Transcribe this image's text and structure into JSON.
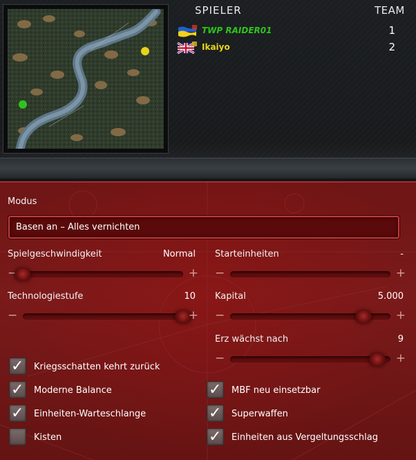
{
  "players_header": "SPIELER",
  "team_header": "TEAM",
  "players": [
    {
      "name": "TWP RAIDER01",
      "team": "1",
      "flag": "ukraine-flag",
      "color": "#2ec41d"
    },
    {
      "name": "Ikaiyo",
      "team": "2",
      "flag": "uk-flag",
      "color": "#e7d51a"
    }
  ],
  "settings": {
    "mode_label": "Modus",
    "mode_value": "Basen an – Alles vernichten",
    "game_speed": {
      "label": "Spielgeschwindigkeit",
      "value": "Normal",
      "position": 0.0
    },
    "start_units": {
      "label": "Starteinheiten",
      "value": "-",
      "position": 0.0
    },
    "tech_level": {
      "label": "Technologiestufe",
      "value": "10",
      "position": 1.0
    },
    "capital": {
      "label": "Kapital",
      "value": "5.000",
      "position": 0.83
    },
    "ore_growth": {
      "label": "Erz wächst nach",
      "value": "9",
      "position": 0.92
    }
  },
  "options": [
    {
      "label": "Kriegsschatten kehrt zurück",
      "checked": true
    },
    {
      "label": "Moderne Balance",
      "checked": true
    },
    {
      "label": "Einheiten-Warteschlange",
      "checked": true
    },
    {
      "label": "Kisten",
      "checked": false
    },
    {
      "label": "MBF neu einsetzbar",
      "checked": true
    },
    {
      "label": "Superwaffen",
      "checked": true
    },
    {
      "label": "Einheiten aus Vergeltungsschlag",
      "checked": true
    }
  ],
  "slider_symbols": {
    "minus": "−",
    "plus": "+"
  },
  "check_symbol": "✓",
  "colors": {
    "panel": "#7a1a1a",
    "accent": "#c23a3a",
    "player1": "#2ec41d",
    "player2": "#e7d51a"
  }
}
